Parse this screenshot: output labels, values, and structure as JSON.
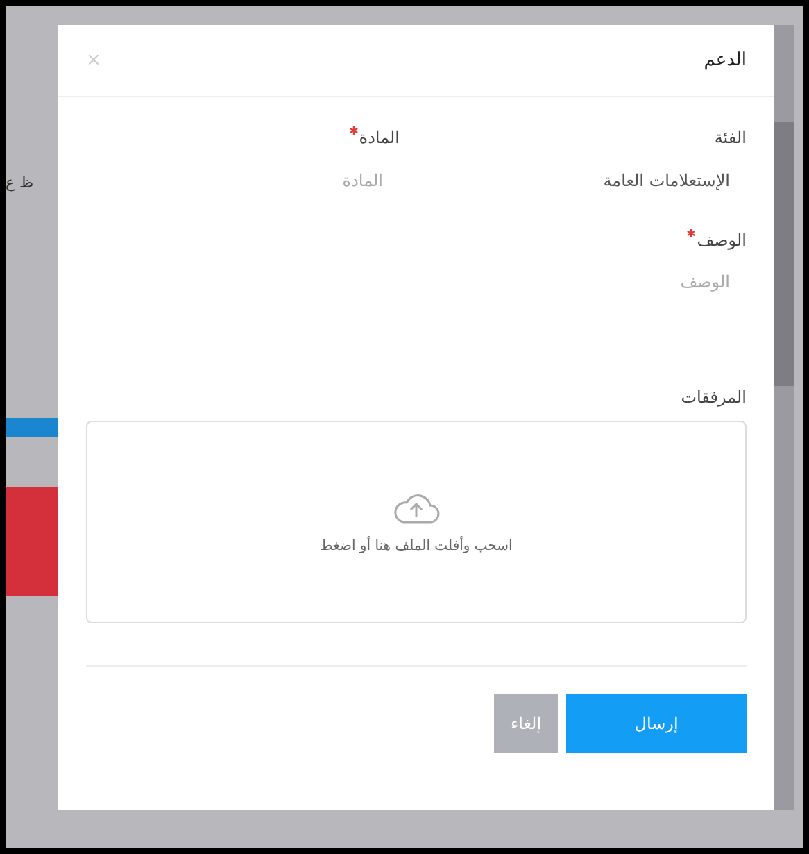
{
  "background": {
    "text": "ظ ع"
  },
  "dialog": {
    "title": "الدعم",
    "close": "×",
    "category": {
      "label": "الفئة",
      "value": "الإستعلامات العامة"
    },
    "subject": {
      "label": "المادة",
      "required": true,
      "placeholder": "المادة"
    },
    "description": {
      "label": "الوصف",
      "required": true,
      "placeholder": "الوصف"
    },
    "attachments": {
      "label": "المرفقات",
      "hint": "اسحب وأفلت الملف هنا أو اضغط"
    },
    "buttons": [
      {
        "kind": "primary",
        "label": "إرسال"
      },
      {
        "kind": "secondary",
        "label": "إلغاء"
      }
    ]
  }
}
